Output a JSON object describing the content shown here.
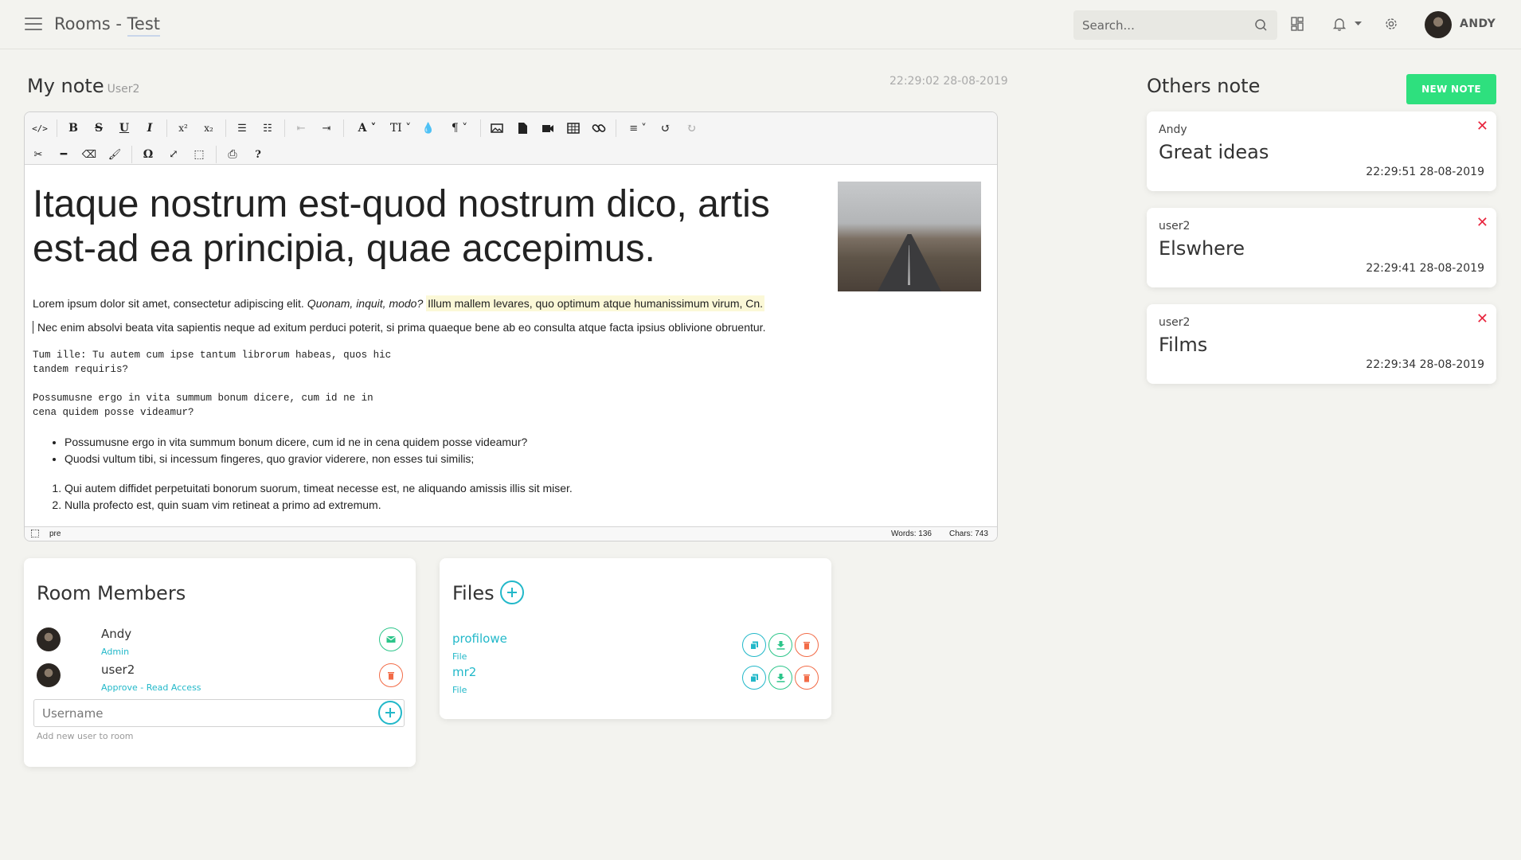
{
  "header": {
    "app_name": "Rooms - ",
    "room_name": "Test",
    "search_placeholder": "Search...",
    "user_name": "ANDY"
  },
  "my_note": {
    "title": "My note",
    "owner": "User2",
    "timestamp": "22:29:02 28-08-2019"
  },
  "editor": {
    "heading": "Itaque nostrum est-quod nostrum dico, artis est-ad ea principia, quae accepimus.",
    "p1_plain": "Lorem ipsum dolor sit amet, consectetur adipiscing elit. ",
    "p1_italic": "Quonam, inquit, modo?",
    "p1_highlight": "Illum mallem levares, quo optimum atque humanissimum virum, Cn.",
    "p2": "Nec enim absolvi beata vita sapientis neque ad exitum perduci poterit, si prima quaeque bene ab eo consulta atque facta ipsius oblivione obruentur.",
    "mono1": "Tum ille: Tu autem cum ipse tantum librorum habeas, quos hic\ntandem requiris?",
    "mono2": "Possumusne ergo in vita summum bonum dicere, cum id ne in\ncena quidem posse videamur?",
    "bullets": [
      "Possumusne ergo in vita summum bonum dicere, cum id ne in cena quidem posse videamur?",
      "Quodsi vultum tibi, si incessum fingeres, quo gravior viderere, non esses tui similis;"
    ],
    "numbered": [
      "Qui autem diffidet perpetuitati bonorum suorum, timeat necesse est, ne aliquando amissis illis sit miser.",
      "Nulla profecto est, quin suam vim retineat a primo ad extremum."
    ],
    "status_tag": "pre",
    "words": "Words: 136",
    "chars": "Chars: 743"
  },
  "members": {
    "title": "Room Members",
    "list": [
      {
        "name": "Andy",
        "role": "Admin"
      },
      {
        "name": "user2",
        "role": "Approve - Read Access"
      }
    ],
    "input_placeholder": "Username",
    "hint": "Add new user to room"
  },
  "files": {
    "title": "Files",
    "list": [
      {
        "name": "profilowe",
        "type": "File"
      },
      {
        "name": "mr2",
        "type": "File"
      }
    ]
  },
  "others": {
    "title": "Others note",
    "new_button": "NEW NOTE",
    "notes": [
      {
        "author": "Andy",
        "title": "Great ideas",
        "time": "22:29:51 28-08-2019"
      },
      {
        "author": "user2",
        "title": "Elswhere",
        "time": "22:29:41 28-08-2019"
      },
      {
        "author": "user2",
        "title": "Films",
        "time": "22:29:34 28-08-2019"
      }
    ]
  },
  "colors": {
    "accent_green": "#2ee07e",
    "teal": "#22b8c9",
    "danger": "#e8263e",
    "orange": "#f26b47"
  }
}
